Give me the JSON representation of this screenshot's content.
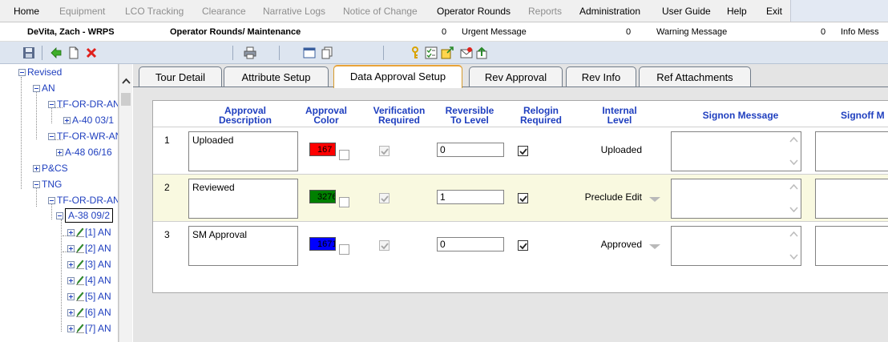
{
  "menu": {
    "items": [
      {
        "label": "Home",
        "enabled": true
      },
      {
        "label": "Equipment",
        "enabled": false
      },
      {
        "label": "LCO Tracking",
        "enabled": false
      },
      {
        "label": "Clearance",
        "enabled": false
      },
      {
        "label": "Narrative Logs",
        "enabled": false
      },
      {
        "label": "Notice of Change",
        "enabled": false
      },
      {
        "label": "Operator Rounds",
        "enabled": true
      },
      {
        "label": "Reports",
        "enabled": false
      },
      {
        "label": "Administration",
        "enabled": true
      },
      {
        "label": "User Guide",
        "enabled": true
      },
      {
        "label": "Help",
        "enabled": true
      },
      {
        "label": "Exit",
        "enabled": true
      }
    ]
  },
  "info": {
    "user": "DeVita, Zach - WRPS",
    "module": "Operator Rounds/ Maintenance",
    "urgent_count": "0",
    "urgent_label": "Urgent Message",
    "warning_count": "0",
    "warning_label": "Warning Message",
    "info_count": "0",
    "info_label": "Info Mess"
  },
  "tree": {
    "nodes": {
      "revised": "Revised",
      "an": "AN",
      "tf_or_dr_1": "TF-OR-DR-AN",
      "a40": "A-40 03/1",
      "tf_or_wr": "TF-OR-WR-AN",
      "a48": "A-48 06/16",
      "pcs": "P&CS",
      "tng": "TNG",
      "tf_or_dr_2": "TF-OR-DR-AN",
      "a38": "A-38 09/2",
      "items": [
        "[1] AN",
        "[2] AN",
        "[3] AN",
        "[4] AN",
        "[5] AN",
        "[6] AN",
        "[7] AN"
      ]
    }
  },
  "tabs": [
    {
      "label": "Tour Detail",
      "active": false
    },
    {
      "label": "Attribute Setup",
      "active": false
    },
    {
      "label": "Data Approval Setup",
      "active": true
    },
    {
      "label": "Rev Approval",
      "active": false
    },
    {
      "label": "Rev Info",
      "active": false
    },
    {
      "label": "Ref Attachments",
      "active": false
    }
  ],
  "grid": {
    "headers": {
      "approval_description": "Approval Description",
      "approval_color": "Approval Color",
      "verification_required": "Verification Required",
      "reversible_to_level": "Reversible To Level",
      "relogin_required": "Relogin Required",
      "internal_level": "Internal Level",
      "signon_message": "Signon Message",
      "signoff_message": "Signoff M"
    },
    "rows": [
      {
        "num": "1",
        "description": "Uploaded",
        "color_value": "167",
        "color_hex": "#ff0000",
        "verification": true,
        "reversible_level": "0",
        "relogin": true,
        "internal_level": "Uploaded",
        "has_dropdown": false
      },
      {
        "num": "2",
        "description": "Reviewed",
        "color_value": "3276",
        "color_hex": "#008000",
        "verification": true,
        "reversible_level": "1",
        "relogin": true,
        "internal_level": "Preclude Edit",
        "has_dropdown": true
      },
      {
        "num": "3",
        "description": "SM Approval",
        "color_value": "1671",
        "color_hex": "#0000ff",
        "verification": true,
        "reversible_level": "0",
        "relogin": true,
        "internal_level": "Approved",
        "has_dropdown": true
      }
    ]
  },
  "colors": {
    "accent_text": "#1f3fbf",
    "active_tab_border": "#e8a33a",
    "toolbar_bg": "#dde5f0"
  }
}
